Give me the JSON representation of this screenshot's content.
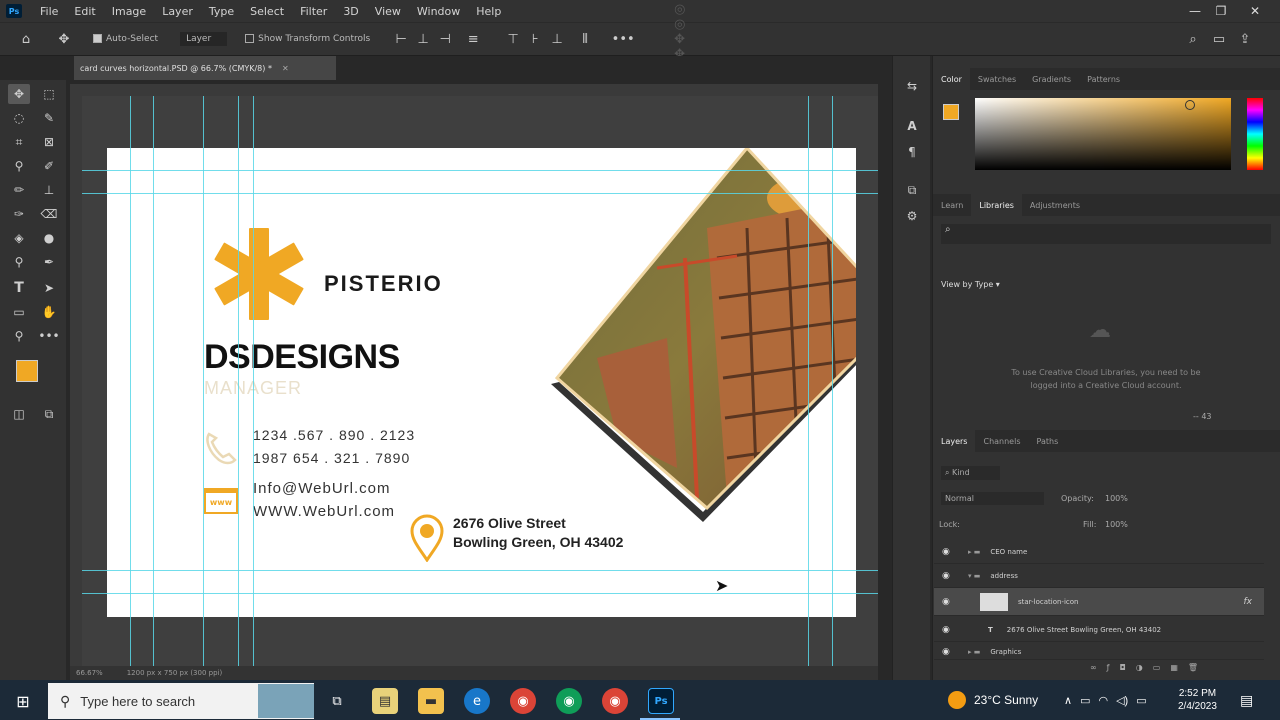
{
  "menu": [
    "File",
    "Edit",
    "Image",
    "Layer",
    "Type",
    "Select",
    "Filter",
    "3D",
    "View",
    "Window",
    "Help"
  ],
  "options": {
    "auto_select_label": "Auto-Select",
    "auto_select_target": "Layer",
    "transform_label": "Show Transform Controls"
  },
  "document": {
    "tab_title": "card curves horizontal.PSD @ 66.7% (CMYK/8) *",
    "zoom": "66.67%",
    "doc_size": "1200 px x 750 px (300 ppi)"
  },
  "card": {
    "brand": "PISTERIO",
    "name": "DSDESIGNS",
    "title": "MANAGER",
    "phone1": "1234 .567 . 890 . 2123",
    "phone2": "1987  654 . 321 . 7890",
    "email": "Info@WebUrl.com",
    "website": "WWW.WebUrl.com",
    "address1": "2676 Olive Street",
    "address2": "Bowling Green, OH 43402",
    "www_badge": "www",
    "accent": "#f0a824"
  },
  "panels": {
    "color_tabs": [
      "Color",
      "Swatches",
      "Gradients",
      "Patterns"
    ],
    "lib_tabs": [
      "Learn",
      "Libraries",
      "Adjustments"
    ],
    "view_by": "View by Type",
    "lib_message": "To use Creative Cloud Libraries, you need to be logged into a Creative Cloud account.",
    "lib_count": "-- 43",
    "layer_tabs": [
      "Layers",
      "Channels",
      "Paths"
    ],
    "kind": "Kind",
    "blend_mode": "Normal",
    "opacity_label": "Opacity:",
    "opacity_value": "100%",
    "lock_label": "Lock:",
    "fill_label": "Fill:",
    "fill_value": "100%",
    "layers": [
      {
        "name": "CEO name"
      },
      {
        "name": "address"
      },
      {
        "name": "star-location-icon",
        "fx": "fx"
      },
      {
        "name": "2676 Olive Street Bowling Green, OH 43402"
      },
      {
        "name": "Graphics"
      }
    ]
  },
  "taskbar": {
    "search_placeholder": "Type here to search",
    "weather": "23°C  Sunny",
    "time": "2:52 PM",
    "date": "2/4/2023"
  }
}
